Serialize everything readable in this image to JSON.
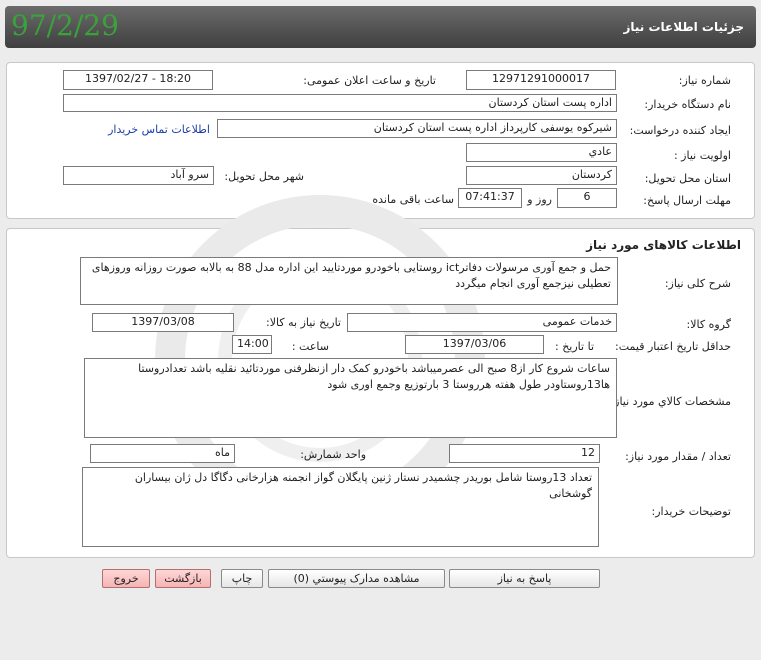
{
  "header": {
    "title": "جزئیات اطلاعات نیاز",
    "date_stamp": "97/2/29"
  },
  "need": {
    "need_number_label": "شماره نیاز:",
    "need_number": "1297129100001‌7",
    "announce_label": "تاریخ و ساعت اعلان عمومی:",
    "announce_value": "1397/02/27 - 18:20",
    "buyer_label": "نام دستگاه خریدار:",
    "buyer_value": "اداره پست استان کردستان",
    "creator_label": "ایجاد کننده درخواست:",
    "creator_value": "شیرکوه یوسفی کارپرداز اداره پست استان کردستان",
    "contact_link": "اطلاعات تماس خریدار",
    "priority_label": "اولویت نیاز :",
    "priority_value": "عادي",
    "province_label": "استان محل تحویل:",
    "province_value": "کردستان",
    "city_label": "شهر محل تحویل:",
    "city_value": "سرو آباد",
    "deadline_label": "مهلت ارسال پاسخ:",
    "days_value": "6",
    "days_unit": "روز و",
    "time_value": "07:41:37",
    "remaining_label": "ساعت باقی مانده"
  },
  "goods": {
    "section_title": "اطلاعات کالاهای مورد نیاز",
    "summary_label": "شرح کلی نیاز:",
    "summary_value": "حمل و جمع آوری مرسولات دفاترict روستایی باخودرو موردتایید این اداره مدل 88 به بالابه صورت روزانه وروزهای تعطیلی نیزجمع آوری انجام میگردد",
    "group_label": "گروه کالا:",
    "group_value": "خدمات عمومی",
    "need_date_label": "تاریخ نیاز به کالا:",
    "need_date_value": "1397/03/08",
    "price_valid_label": "حداقل تاریخ اعتبار قیمت:",
    "until_date_label": "تا تاریخ :",
    "until_date_value": "1397/03/06",
    "hour_label": "ساعت :",
    "hour_value": "14:00",
    "spec_label": "مشخصات کالاي مورد نیاز:",
    "spec_value": "ساعات شروع کار از8 صبح الی عصرمیباشد باخودرو کمک دار ازنظرفنی موردتائید نقلیه باشد تعدادروستا ها13روستاودر طول هفته هرروستا 3 بارتوزیع وجمع اوری شود",
    "qty_label": "تعداد / مقدار مورد نیاز:",
    "qty_value": "12",
    "unit_label": "واحد شمارش:",
    "unit_value": "ماه",
    "buyer_notes_label": "توضیحات خریدار:",
    "buyer_notes_value": "تعداد 13روستا شامل بوریدر چشمیدر نستار ژنین پایگلان گواز انجمنه هزارخانی دگاگا دل ژان بیساران گوشخانی"
  },
  "buttons": {
    "reply": "پاسخ به نیاز",
    "attachments": "مشاهده مدارک پیوستي (0)",
    "print": "چاپ",
    "back": "بازگشت",
    "exit": "خروج"
  }
}
